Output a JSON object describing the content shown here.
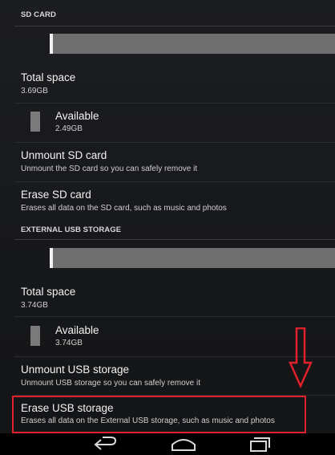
{
  "sd_card": {
    "header": "SD CARD",
    "usage_fraction": 0.01,
    "total_space": {
      "title": "Total space",
      "value": "3.69GB"
    },
    "available": {
      "title": "Available",
      "value": "2.49GB"
    },
    "unmount": {
      "title": "Unmount SD card",
      "subtitle": "Unmount the SD card so you can safely remove it"
    },
    "erase": {
      "title": "Erase SD card",
      "subtitle": "Erases all data on the SD card, such as music and photos"
    }
  },
  "usb_storage": {
    "header": "EXTERNAL USB STORAGE",
    "usage_fraction": 0.01,
    "total_space": {
      "title": "Total space",
      "value": "3.74GB"
    },
    "available": {
      "title": "Available",
      "value": "3.74GB"
    },
    "unmount": {
      "title": "Unmount USB storage",
      "subtitle": "Unmount USB storage so you can safely remove it"
    },
    "erase": {
      "title": "Erase USB storage",
      "subtitle": "Erases all data on the External USB storage, such as music and photos"
    }
  },
  "annotation": {
    "color": "#e0202a",
    "icon": "down-arrow-icon"
  },
  "nav": {
    "back_icon": "back-icon",
    "home_icon": "home-icon",
    "recents_icon": "recents-icon"
  }
}
